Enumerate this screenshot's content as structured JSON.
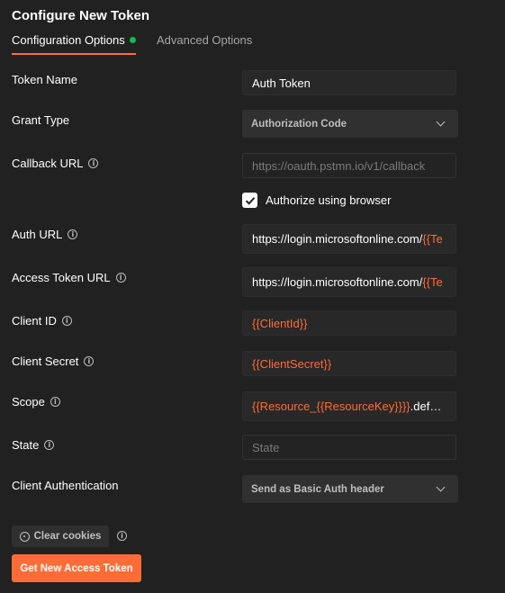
{
  "page": {
    "title": "Configure New Token"
  },
  "tabs": [
    {
      "label": "Configuration Options",
      "active": true,
      "status_color": "#0cbb52"
    },
    {
      "label": "Advanced Options",
      "active": false
    }
  ],
  "fields": {
    "token_name": {
      "label": "Token Name",
      "value": "Auth Token"
    },
    "grant_type": {
      "label": "Grant Type",
      "value": "Authorization Code"
    },
    "callback_url": {
      "label": "Callback URL",
      "placeholder": "https://oauth.pstmn.io/v1/callback"
    },
    "authorize_browser": {
      "label": "Authorize using browser",
      "checked": true
    },
    "auth_url": {
      "label": "Auth URL",
      "value_prefix": "https://login.microsoftonline.com/",
      "value_var": "{{Te"
    },
    "access_token_url": {
      "label": "Access Token URL",
      "value_prefix": "https://login.microsoftonline.com/",
      "value_var": "{{Te"
    },
    "client_id": {
      "label": "Client ID",
      "value_var": "{{ClientId}}"
    },
    "client_secret": {
      "label": "Client Secret",
      "value_var": "{{ClientSecret}}"
    },
    "scope": {
      "label": "Scope",
      "value_var": "{{Resource_{{ResourceKey}}}}",
      "value_suffix": ".default"
    },
    "state": {
      "label": "State",
      "placeholder": "State"
    },
    "client_auth": {
      "label": "Client Authentication",
      "value": "Send as Basic Auth header"
    }
  },
  "buttons": {
    "clear_cookies": "Clear cookies",
    "get_token": "Get New Access Token"
  },
  "icons": {
    "info": "info-icon",
    "chevron": "chevron-down-icon",
    "cookie": "cookie-icon",
    "check": "checkmark-icon"
  },
  "colors": {
    "accent": "#ff6c37",
    "status": "#0cbb52",
    "background": "#212121"
  }
}
